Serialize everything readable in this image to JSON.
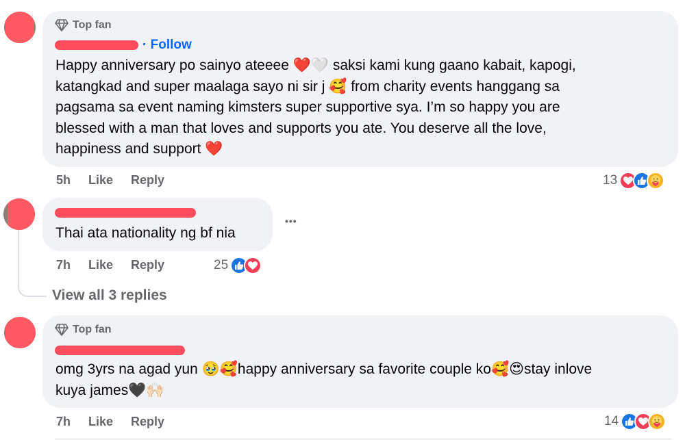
{
  "colors": {
    "bubble": "#f0f2f5",
    "link": "#0866ff",
    "muted": "#65676b",
    "redaction": "#ff4c5c",
    "love": "#f33e58",
    "like": "#1b74e4",
    "care": "#f7b125"
  },
  "comments": [
    {
      "badge": "Top fan",
      "follow": "· Follow",
      "text": "Happy anniversary po sainyo ateeee ❤️🤍 saksi kami kung gaano kabait, kapogi,\nkatangkad and super maalaga sayo ni sir j 🥰 from charity events hanggang sa\npagsama sa event naming kimsters super supportive sya. I’m so happy you are\nblessed with a man that loves and supports you ate. You deserve all the love,\nhappiness and support ❤️",
      "time": "5h",
      "like": "Like",
      "reply": "Reply",
      "reaction_count": "13",
      "reactions": [
        "love-icon",
        "like-icon",
        "care-icon"
      ]
    },
    {
      "text": "Thai ata nationality ng bf nia",
      "time": "7h",
      "like": "Like",
      "reply": "Reply",
      "reaction_count": "25",
      "reactions": [
        "like-icon",
        "love-icon"
      ],
      "more": "•••"
    },
    {
      "badge": "Top fan",
      "text": "omg 3yrs na agad yun 🥹🥰happy anniversary sa favorite couple ko🥰😍stay inlove\nkuya james🖤🙌🏻",
      "time": "7h",
      "like": "Like",
      "reply": "Reply",
      "reaction_count": "14",
      "reactions": [
        "like-icon",
        "love-icon",
        "care-icon"
      ]
    }
  ],
  "view_replies": "View all 3 replies"
}
